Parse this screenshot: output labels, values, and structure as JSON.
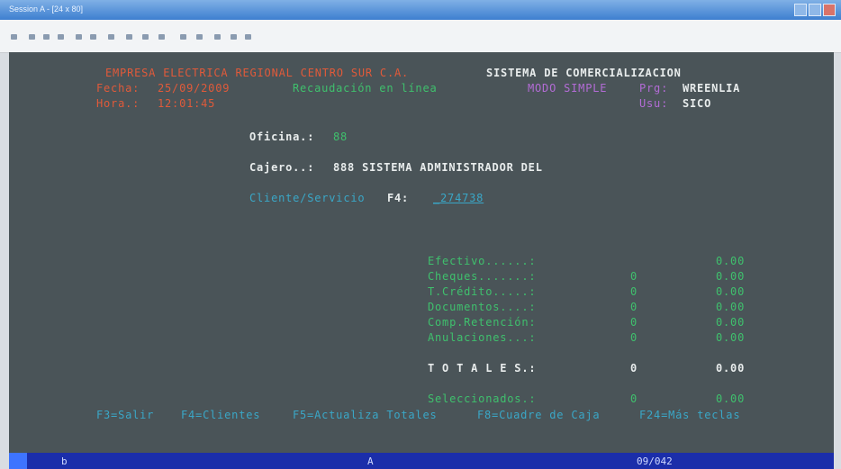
{
  "window": {
    "title": "Session A - [24 x 80]"
  },
  "screen": {
    "header": {
      "company": "EMPRESA ELECTRICA REGIONAL CENTRO SUR C.A.",
      "system": "SISTEMA DE COMERCIALIZACION",
      "date_label": "Fecha:",
      "date_value": "25/09/2009",
      "module": "Recaudación en línea",
      "mode": "MODO SIMPLE",
      "prg_label": "Prg:",
      "prg_value": "WREENLIA",
      "time_label": "Hora.:",
      "time_value": "12:01:45",
      "user_label": "Usu:",
      "user_value": "SICO"
    },
    "office_label": "Oficina.:",
    "office_value": "88",
    "cashier_label": "Cajero..:",
    "cashier_value": "888 SISTEMA ADMINISTRADOR DEL",
    "client_label": "Cliente/Servicio",
    "client_key": "F4:",
    "client_value": "_274738",
    "payments": [
      {
        "label": "Efectivo......:",
        "count": "",
        "amount": "0.00"
      },
      {
        "label": "Cheques.......:",
        "count": "0",
        "amount": "0.00"
      },
      {
        "label": "T.Crédito.....:",
        "count": "0",
        "amount": "0.00"
      },
      {
        "label": "Documentos....:",
        "count": "0",
        "amount": "0.00"
      },
      {
        "label": "Comp.Retención:",
        "count": "0",
        "amount": "0.00"
      },
      {
        "label": "Anulaciones...:",
        "count": "0",
        "amount": "0.00"
      }
    ],
    "totals": {
      "label": "T O T A L E S.:",
      "count": "0",
      "amount": "0.00"
    },
    "selected": {
      "label": "Seleccionados.:",
      "count": "0",
      "amount": "0.00"
    },
    "function_keys": [
      "F3=Salir",
      "F4=Clientes",
      "F5=Actualiza Totales",
      "F8=Cuadre de Caja",
      "F24=Más teclas"
    ]
  },
  "status_bar": {
    "left": "b",
    "mid": "A",
    "cursor": "09/042"
  },
  "colors": {
    "screen_bg": "#4a5458",
    "orange": "#e05a3a",
    "green": "#3fc06d",
    "white": "#e8ecec",
    "cyan": "#3aa7c7",
    "magenta": "#b36cd6"
  }
}
